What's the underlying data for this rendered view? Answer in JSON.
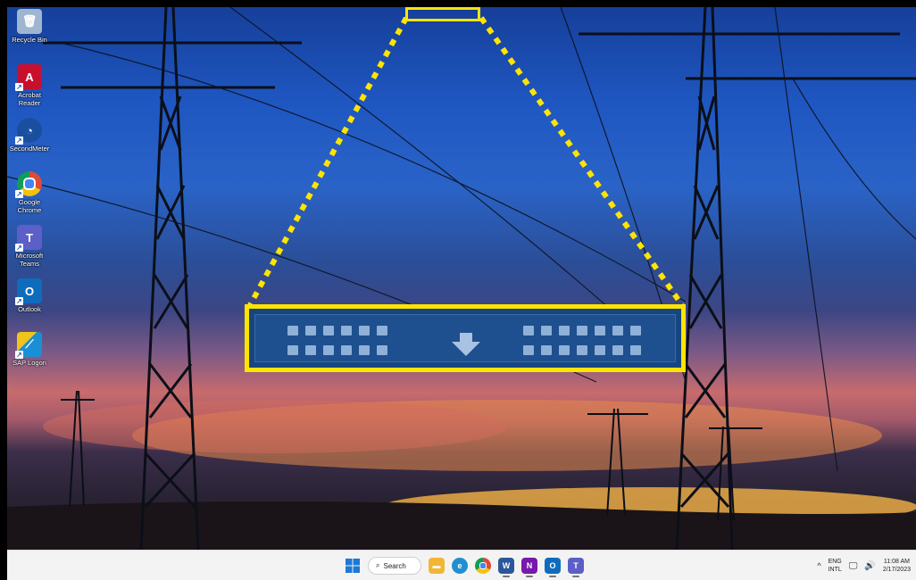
{
  "desktop": {
    "icons": [
      {
        "label": "Recycle Bin",
        "icon": "recycle-bin-icon",
        "color": "#9fb6d0"
      },
      {
        "label": "Acrobat Reader",
        "icon": "acrobat-reader-icon",
        "color": "#c8102e"
      },
      {
        "label": "SecondMeter",
        "icon": "secondmeter-icon",
        "color": "#1a4fa0"
      },
      {
        "label": "Google Chrome",
        "icon": "google-chrome-icon",
        "color": "#dd4b39"
      },
      {
        "label": "Microsoft Teams",
        "icon": "microsoft-teams-icon",
        "color": "#5b5fc7"
      },
      {
        "label": "Outlook",
        "icon": "outlook-icon",
        "color": "#0f6cbd"
      },
      {
        "label": "SAP Logon",
        "icon": "sap-logon-icon",
        "color": "#1b8fd6"
      }
    ]
  },
  "taskbar": {
    "search_label": "Search",
    "apps": [
      {
        "name": "start",
        "icon": "windows-start-icon",
        "color": "#1e78d6"
      },
      {
        "name": "file-explorer",
        "icon": "folder-icon",
        "color": "#f2b637"
      },
      {
        "name": "edge",
        "icon": "edge-icon",
        "color": "#1f8fcf"
      },
      {
        "name": "chrome",
        "icon": "chrome-icon",
        "color": "#dd4b39"
      },
      {
        "name": "word",
        "icon": "word-icon",
        "color": "#2b579a"
      },
      {
        "name": "onenote",
        "icon": "onenote-icon",
        "color": "#7719aa"
      },
      {
        "name": "outlook",
        "icon": "outlook-icon",
        "color": "#0f6cbd"
      },
      {
        "name": "teams",
        "icon": "teams-icon",
        "color": "#5b5fc7"
      }
    ],
    "tray": {
      "language_top": "ENG",
      "language_bottom": "INTL",
      "time": "11:08 AM",
      "date": "2/17/2023"
    }
  },
  "annotation": {
    "highlight_color": "#ffe400",
    "zoom_panel_background": "#1e4f8e"
  }
}
